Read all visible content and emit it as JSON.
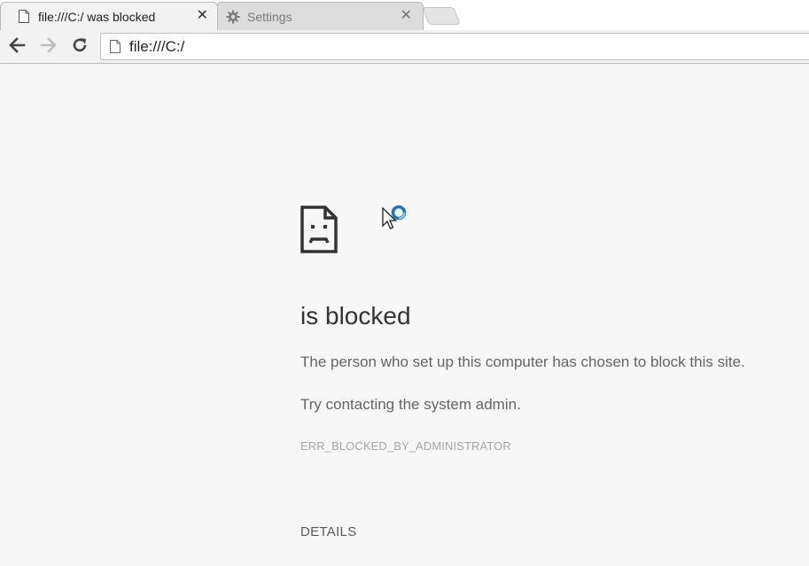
{
  "tabs": [
    {
      "title": "file:///C:/ was blocked",
      "icon": "page-icon",
      "close_label": "✕"
    },
    {
      "title": "Settings",
      "icon": "gear-icon",
      "close_label": "✕"
    }
  ],
  "toolbar": {
    "url": "file:///C:/",
    "back_icon": "back-arrow-icon",
    "forward_icon": "forward-arrow-icon",
    "reload_icon": "reload-icon"
  },
  "error_page": {
    "icon": "sad-page-icon",
    "heading": "is blocked",
    "message": "The person who set up this computer has chosen to block this site.",
    "suggestion": "Try contacting the system admin.",
    "error_code": "ERR_BLOCKED_BY_ADMINISTRATOR",
    "details_label": "DETAILS"
  },
  "colors": {
    "page_background": "#f7f7f7",
    "heading": "#333333",
    "body_text": "#646464",
    "error_code": "#a6a6a6",
    "cursor_spinner": "#3b9be0"
  }
}
